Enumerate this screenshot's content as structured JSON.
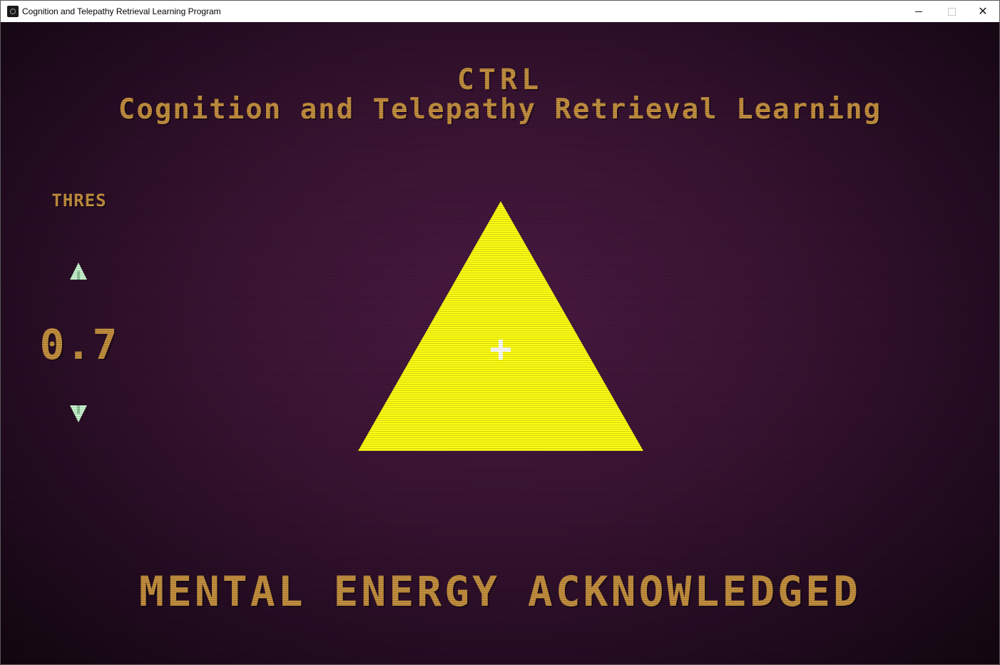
{
  "window": {
    "title": "Cognition and Telepathy Retrieval Learning Program",
    "icon": "app-icon"
  },
  "titlebar_buttons": {
    "minimize_icon": "minimize-icon",
    "maximize_icon": "maximize-icon",
    "close_icon": "close-icon",
    "close_glyph": "✕"
  },
  "game": {
    "title": "CTRL",
    "subtitle": "Cognition and Telepathy Retrieval Learning",
    "threshold": {
      "label": "THRES",
      "value": "0.7",
      "increase_icon": "arrow-up-icon",
      "decrease_icon": "arrow-down-icon",
      "arrow_color": "#c9f5cf"
    },
    "stimulus": {
      "shape": "triangle",
      "color": "#ffff14",
      "marker_icon": "crosshair-icon"
    },
    "status": "MENTAL ENERGY ACKNOWLEDGED"
  },
  "colors": {
    "text_gold": "#c4903f",
    "background": "#3a1433"
  }
}
